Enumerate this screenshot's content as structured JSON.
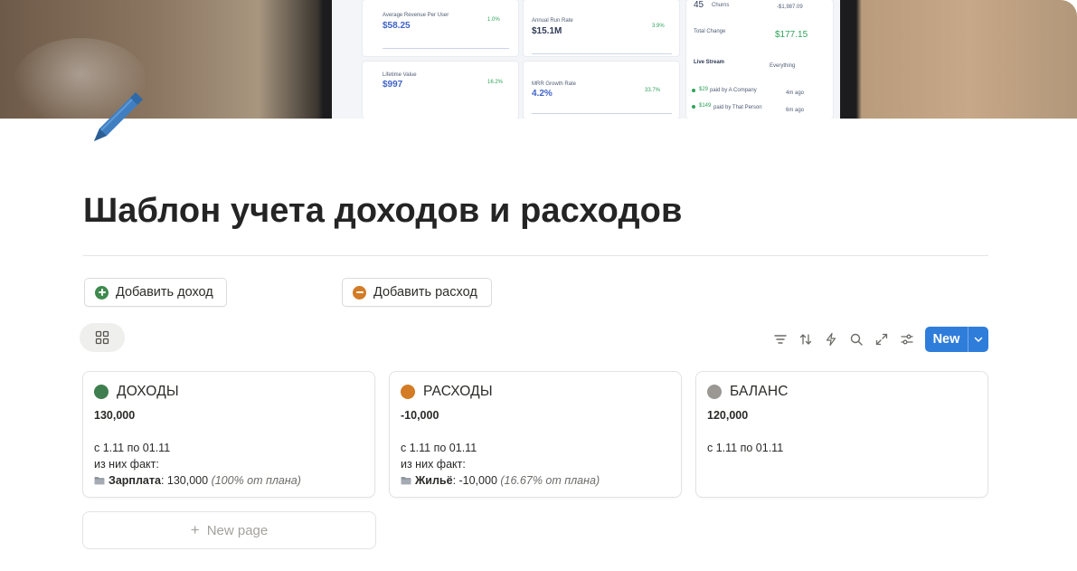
{
  "cover": {
    "dashboard": {
      "avg_revenue_label": "Average Revenue Per User",
      "avg_revenue_value": "$58.25",
      "avg_revenue_change": "1.0%",
      "run_rate_label": "Annual Run Rate",
      "run_rate_value": "$15.1M",
      "run_rate_change": "3.9%",
      "churns_count": "45",
      "churns_label": "Churns",
      "churns_value": "-$1,987.09",
      "total_change_label": "Total Change",
      "total_change_value": "$177.15",
      "lifetime_label": "Lifetime Value",
      "lifetime_value": "$997",
      "lifetime_change": "16.2%",
      "mrr_label": "MRR Growth Rate",
      "mrr_value": "4.2%",
      "mrr_change": "33.7%",
      "live_stream_label": "Live Stream",
      "everything_label": "Everything",
      "stream_1_amount": "$29",
      "stream_1_text": "paid by A Company",
      "stream_1_time": "4m ago",
      "stream_2_amount": "$149",
      "stream_2_text": "paid by That Person",
      "stream_2_time": "6m ago"
    }
  },
  "page": {
    "title": "Шаблон учета доходов и расходов"
  },
  "actions": {
    "add_income": "Добавить доход",
    "add_expense": "Добавить расход"
  },
  "toolbar": {
    "new_label": "New"
  },
  "cards": [
    {
      "name": "ДОХОДЫ",
      "color": "#3f7e4e",
      "amount": "130,000",
      "period": "с 1.11 по 01.11",
      "fact_label": "из них факт:",
      "item_name": "Зарплата",
      "item_value": ": 130,000",
      "item_note": "(100% от плана)"
    },
    {
      "name": "РАСХОДЫ",
      "color": "#d37b25",
      "amount": "-10,000",
      "period": "с 1.11 по 01.11",
      "fact_label": "из них факт:",
      "item_name": "Жильё",
      "item_value": ": -10,000",
      "item_note": "(16.67% от плана)"
    },
    {
      "name": "БАЛАНС",
      "color": "#9b9893",
      "amount": "120,000",
      "period": "с 1.11 по 01.11"
    }
  ],
  "new_page_label": "New page"
}
